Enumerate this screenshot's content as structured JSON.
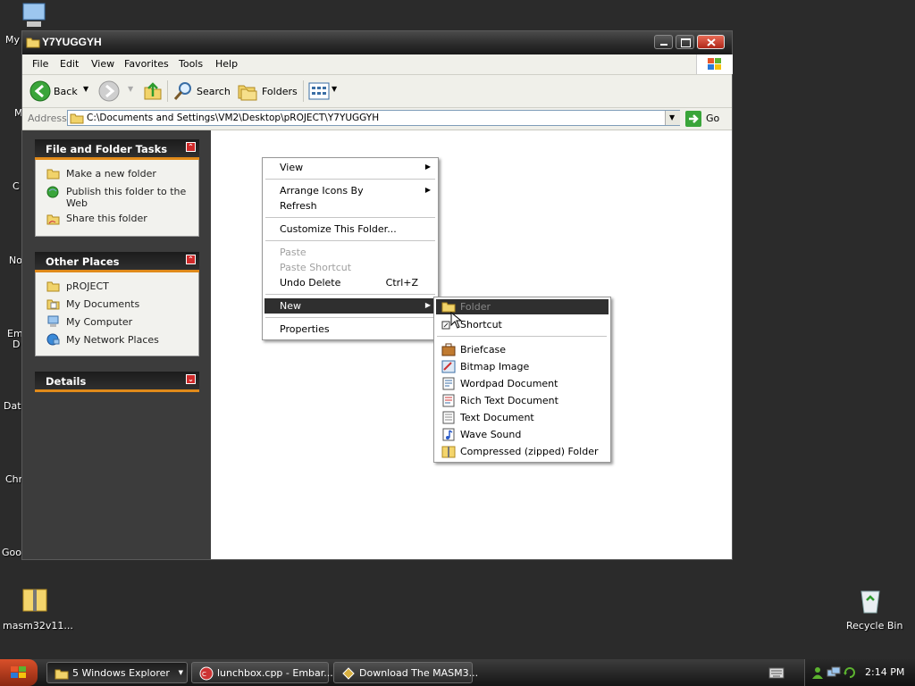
{
  "desktop": {
    "left_labels": [
      "My",
      "M",
      "C",
      "No",
      "Em",
      "D",
      "Data",
      "Chr",
      "Goo"
    ],
    "masm_label": "masm32v11...",
    "recycle_label": "Recycle Bin"
  },
  "window": {
    "title": "Y7YUGGYH",
    "menu": [
      "File",
      "Edit",
      "View",
      "Favorites",
      "Tools",
      "Help"
    ],
    "toolbar": {
      "back": "Back",
      "search": "Search",
      "folders": "Folders"
    },
    "address": {
      "label": "Address",
      "value": "C:\\Documents and Settings\\VM2\\Desktop\\pROJECT\\Y7YUGGYH",
      "go": "Go"
    }
  },
  "left_pane": {
    "file_tasks": {
      "title": "File and Folder Tasks",
      "items": [
        "Make a new folder",
        "Publish this folder to the",
        "Web",
        "Share this folder"
      ]
    },
    "other_places": {
      "title": "Other Places",
      "items": [
        "pROJECT",
        "My Documents",
        "My Computer",
        "My Network Places"
      ]
    },
    "details": {
      "title": "Details"
    }
  },
  "context_menu": {
    "items": {
      "view": "View",
      "arrange": "Arrange Icons By",
      "refresh": "Refresh",
      "customize": "Customize This Folder...",
      "paste": "Paste",
      "paste_shortcut": "Paste Shortcut",
      "undo": "Undo Delete",
      "undo_shortcut": "Ctrl+Z",
      "new": "New",
      "properties": "Properties"
    }
  },
  "new_submenu": {
    "items": [
      "Folder",
      "Shortcut",
      "Briefcase",
      "Bitmap Image",
      "Wordpad Document",
      "Rich Text Document",
      "Text Document",
      "Wave Sound",
      "Compressed (zipped) Folder"
    ]
  },
  "taskbar": {
    "buttons": [
      "5 Windows Explorer",
      "lunchbox.cpp - Embar...",
      "Download The MASM3..."
    ],
    "clock": "2:14 PM"
  },
  "colors": {
    "accent": "#e08a1a",
    "highlight": "#2f2f2f",
    "close": "#c0392b"
  }
}
